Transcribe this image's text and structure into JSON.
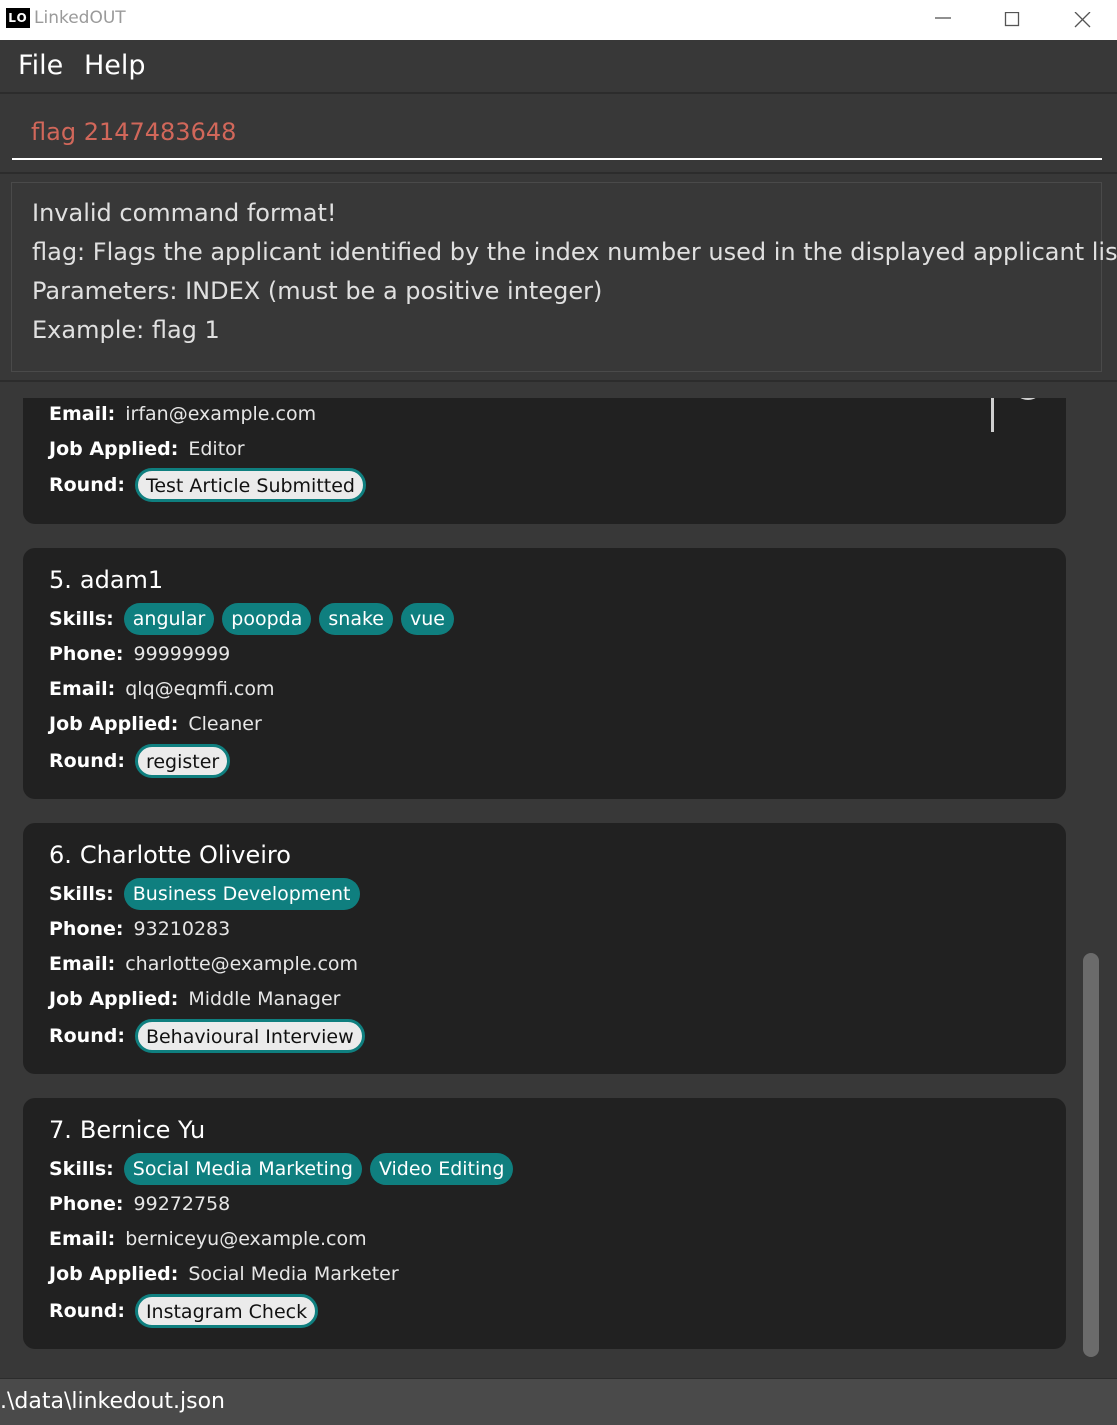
{
  "window": {
    "logo": "LO",
    "title": "LinkedOUT"
  },
  "menu": {
    "file": "File",
    "help": "Help"
  },
  "command": {
    "value": "flag 2147483648"
  },
  "result": {
    "lines": [
      "Invalid command format!",
      "flag: Flags the applicant identified by the index number used in the displayed applicant list",
      "Parameters: INDEX (must be a positive integer)",
      "Example: flag 1"
    ]
  },
  "labels": {
    "skills": "Skills:",
    "phone": "Phone:",
    "email": "Email:",
    "job": "Job Applied:",
    "round": "Round:"
  },
  "partial_applicant": {
    "email": "irfan@example.com",
    "job": "Editor",
    "round": "Test Article Submitted"
  },
  "applicants": [
    {
      "index": "5.",
      "name": "adam1",
      "skills": [
        "angular",
        "poopda",
        "snake",
        "vue"
      ],
      "phone": "99999999",
      "email": "qlq@eqmfi.com",
      "job": "Cleaner",
      "round": "register"
    },
    {
      "index": "6.",
      "name": "Charlotte Oliveiro",
      "skills": [
        "Business Development"
      ],
      "phone": "93210283",
      "email": "charlotte@example.com",
      "job": "Middle Manager",
      "round": "Behavioural Interview"
    },
    {
      "index": "7.",
      "name": "Bernice Yu",
      "skills": [
        "Social Media Marketing",
        "Video Editing"
      ],
      "phone": "99272758",
      "email": "berniceyu@example.com",
      "job": "Social Media Marketer",
      "round": "Instagram Check"
    }
  ],
  "status": {
    "path": ".\\data\\linkedout.json"
  },
  "colors": {
    "accent": "#0f7f7f",
    "command_error": "#d1675a",
    "card_bg": "#212121",
    "panel_bg": "#383838"
  }
}
